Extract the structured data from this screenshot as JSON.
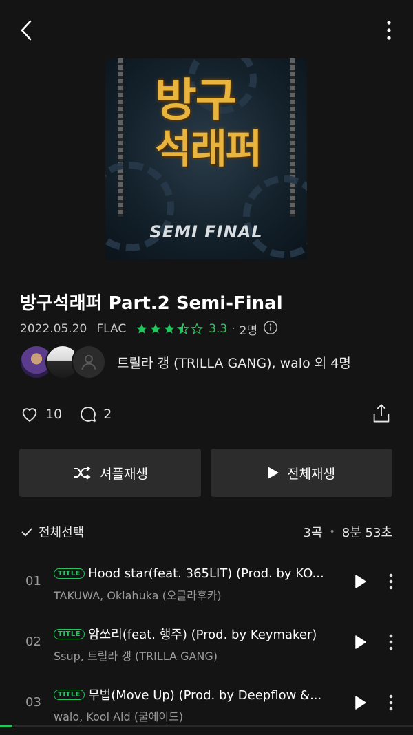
{
  "album": {
    "title": "방구석래퍼 Part.2 Semi-Final",
    "date": "2022.05.20",
    "format": "FLAC",
    "rating_value": "3.3",
    "rating_stars": 3.5,
    "raters": "2명",
    "artists": "트릴라 갱 (TRILLA GANG), walo 외 4명",
    "likes": "10",
    "comments": "2",
    "cover_text": {
      "line1": "방구",
      "line2": "석래퍼",
      "subtitle": "SEMI FINAL"
    }
  },
  "buttons": {
    "shuffle": "셔플재생",
    "play_all": "전체재생"
  },
  "list_header": {
    "select_all": "전체선택",
    "track_count": "3곡",
    "duration": "8분 53초"
  },
  "tracks": [
    {
      "num": "01",
      "badge": "TITLE",
      "title": "Hood star(feat. 365LIT) (Prod. by KO...",
      "artist": "TAKUWA, Oklahuka (오클라후카)"
    },
    {
      "num": "02",
      "badge": "TITLE",
      "title": "암쏘리(feat. 행주) (Prod. by Keymaker)",
      "artist": "Ssup, 트릴라 갱 (TRILLA GANG)"
    },
    {
      "num": "03",
      "badge": "TITLE",
      "title": "무법(Move Up) (Prod. by Deepflow &...",
      "artist": "walo, Kool Aid (쿨에이드)"
    }
  ],
  "playback": {
    "progress": 0.03
  },
  "colors": {
    "accent": "#22c55e",
    "background": "#141414",
    "button": "#2c2c2c"
  },
  "icons": [
    "back-icon",
    "more-vertical-icon",
    "star-icon",
    "info-icon",
    "heart-icon",
    "comment-icon",
    "share-icon",
    "shuffle-icon",
    "play-icon",
    "check-icon"
  ]
}
